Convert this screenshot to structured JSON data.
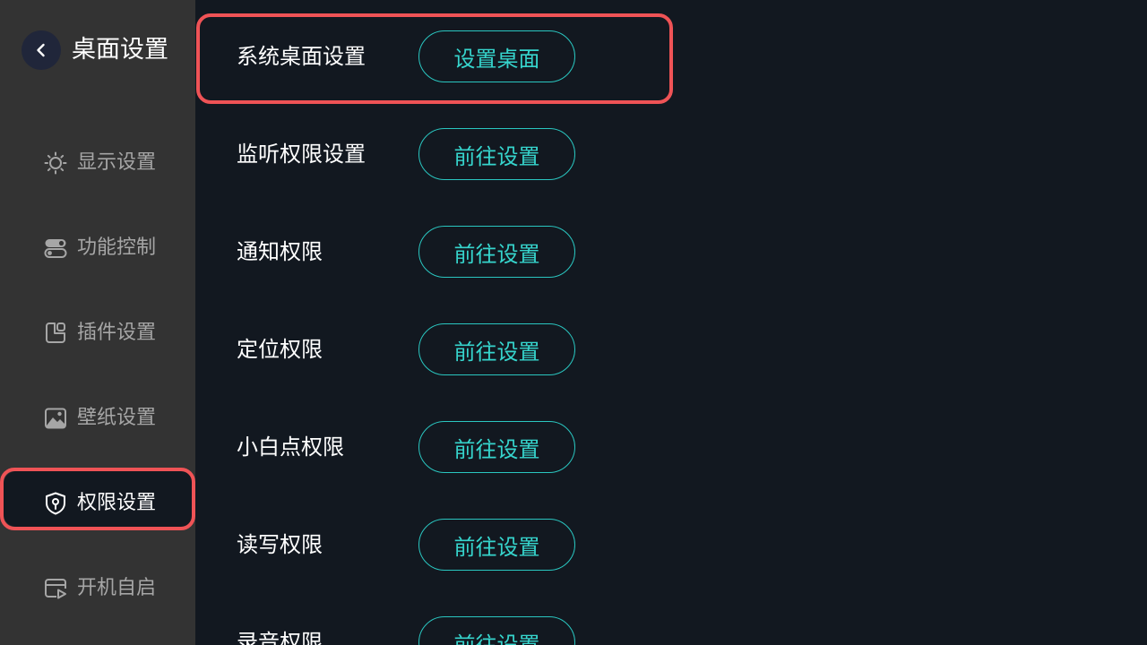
{
  "header": {
    "title": "桌面设置",
    "back_icon": "chevron-left-icon"
  },
  "sidebar": {
    "items": [
      {
        "label": "显示设置",
        "icon": "sun-icon"
      },
      {
        "label": "功能控制",
        "icon": "toggle-icon"
      },
      {
        "label": "插件设置",
        "icon": "widget-icon"
      },
      {
        "label": "壁纸设置",
        "icon": "image-icon"
      },
      {
        "label": "权限设置",
        "icon": "shield-icon",
        "active": true
      },
      {
        "label": "开机自启",
        "icon": "autostart-icon"
      }
    ]
  },
  "main": {
    "rows": [
      {
        "label": "系统桌面设置",
        "button": "设置桌面"
      },
      {
        "label": "监听权限设置",
        "button": "前往设置"
      },
      {
        "label": "通知权限",
        "button": "前往设置"
      },
      {
        "label": "定位权限",
        "button": "前往设置"
      },
      {
        "label": "小白点权限",
        "button": "前往设置"
      },
      {
        "label": "读写权限",
        "button": "前往设置"
      },
      {
        "label": "录音权限",
        "button": "前往设置"
      }
    ]
  },
  "colors": {
    "accent": "#2ac6c0",
    "highlight": "#ef5356",
    "sidebar_bg": "#333333",
    "main_bg": "#121820"
  }
}
